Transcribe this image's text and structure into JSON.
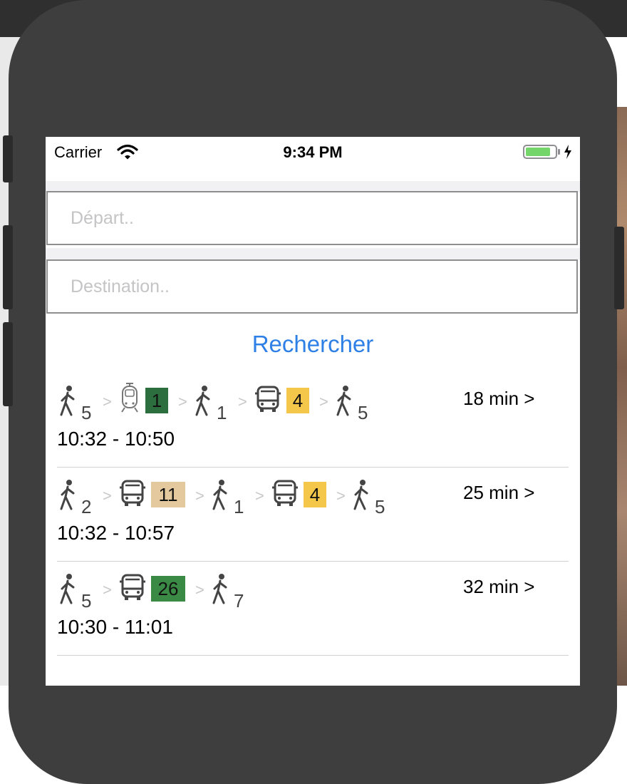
{
  "status_bar": {
    "carrier": "Carrier",
    "time": "9:34 PM"
  },
  "form": {
    "departure_placeholder": "Départ..",
    "destination_placeholder": "Destination..",
    "search_label": "Rechercher"
  },
  "colors": {
    "accent": "#2f80e6"
  },
  "routes": [
    {
      "duration": "18 min >",
      "times": "10:32 - 10:50",
      "legs": [
        {
          "kind": "walk",
          "value": "5"
        },
        {
          "kind": "tram",
          "icon": "tram-icon",
          "line": "1",
          "color": "#2c6e3d",
          "text_color": "#111111"
        },
        {
          "kind": "walk",
          "value": "1"
        },
        {
          "kind": "bus",
          "icon": "bus-icon",
          "line": "4",
          "color": "#f4c64a",
          "text_color": "#111111"
        },
        {
          "kind": "walk",
          "value": "5"
        }
      ]
    },
    {
      "duration": "25 min >",
      "times": "10:32 - 10:57",
      "legs": [
        {
          "kind": "walk",
          "value": "2"
        },
        {
          "kind": "bus",
          "icon": "bus-icon",
          "line": "11",
          "color": "#e3c99d",
          "text_color": "#111111"
        },
        {
          "kind": "walk",
          "value": "1"
        },
        {
          "kind": "bus",
          "icon": "bus-icon",
          "line": "4",
          "color": "#f4c64a",
          "text_color": "#111111"
        },
        {
          "kind": "walk",
          "value": "5"
        }
      ]
    },
    {
      "duration": "32 min >",
      "times": "10:30 - 11:01",
      "legs": [
        {
          "kind": "walk",
          "value": "5"
        },
        {
          "kind": "bus",
          "icon": "bus-icon",
          "line": "26",
          "color": "#3a8a46",
          "text_color": "#111111"
        },
        {
          "kind": "walk",
          "value": "7"
        }
      ]
    }
  ],
  "separator_glyph": ">"
}
